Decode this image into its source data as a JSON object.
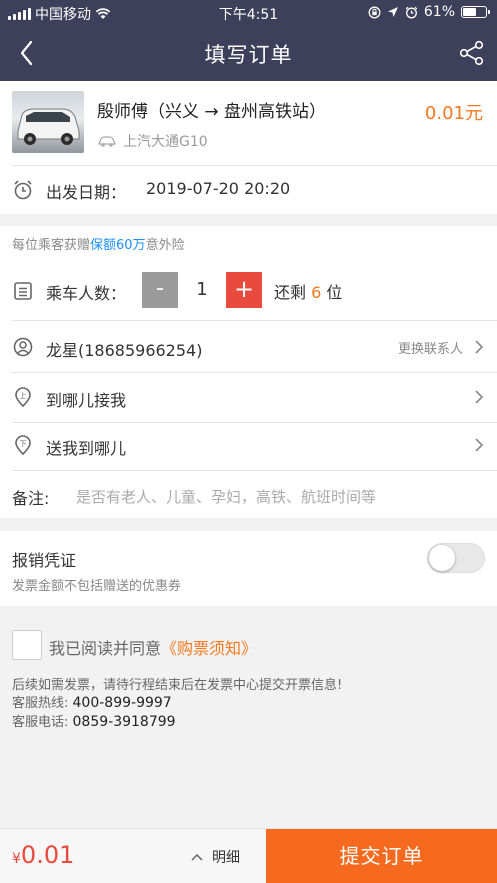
{
  "status_bar": {
    "carrier": "中国移动",
    "time": "下午4:51",
    "battery": "61%",
    "battery_level": 0.61
  },
  "header": {
    "title": "填写订单"
  },
  "trip": {
    "route": "殷师傅（兴义 → 盘州高铁站）",
    "car_model": "上汽大通G10",
    "price": "0.01元",
    "departure_label": "出发日期：",
    "departure_value": "2019-07-20 20:20"
  },
  "passengers": {
    "insurance_prefix": "每位乘客获赠",
    "insurance_highlight": "保额60万",
    "insurance_suffix": "意外险",
    "count_label": "乘车人数：",
    "minus": "-",
    "count": "1",
    "plus": "+",
    "remain_prefix": "还剩",
    "remain_num": "6",
    "remain_suffix": "位",
    "contact": "龙星(18685966254)",
    "change_contact": "更换联系人",
    "pickup_label": "到哪儿接我",
    "dropoff_label": "送我到哪儿",
    "remark_label": "备注:",
    "remark_placeholder": "是否有老人、儿童、孕妇，高铁、航班时间等"
  },
  "invoice": {
    "title": "报销凭证",
    "subtitle": "发票金额不包括赠送的优惠券",
    "enabled": false
  },
  "agreement": {
    "text": "我已阅读并同意",
    "link": "《购票须知》",
    "notice": "后续如需发票，请待行程结束后在发票中心提交开票信息!",
    "hotline_label": "客服热线: ",
    "hotline": "400-899-9997",
    "phone_label": "客服电话: ",
    "phone": "0859-3918799"
  },
  "footer": {
    "currency": "¥",
    "total": "0.01",
    "detail": "明细",
    "submit": "提交订单"
  },
  "colors": {
    "nav_bg": "#3e3f5a",
    "accent": "#f5781e",
    "plus_red": "#e84a3d",
    "link_blue": "#1e90ff",
    "submit": "#f56a1f"
  },
  "icons": [
    "wifi-icon",
    "lock-rotation-icon",
    "location-arrow-icon",
    "alarm-icon",
    "back-chevron-icon",
    "share-icon",
    "car-brand-icon",
    "alarm-clock-icon",
    "passenger-list-icon",
    "contact-icon",
    "pickup-pin-icon",
    "dropoff-pin-icon",
    "chevron-right-icon",
    "chevron-up-icon"
  ]
}
